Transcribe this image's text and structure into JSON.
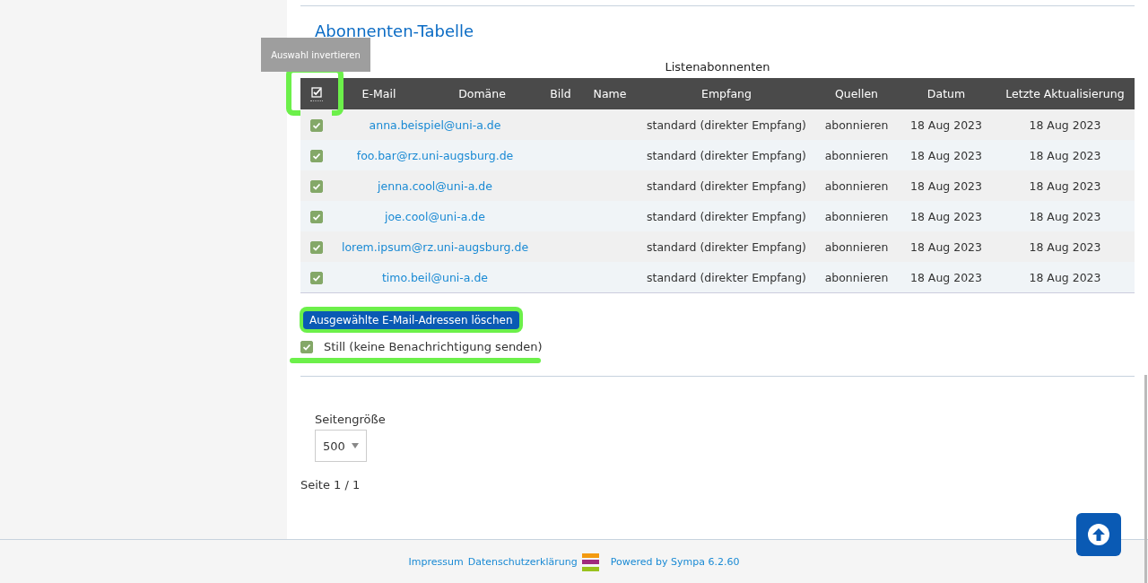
{
  "section_title": "Abonnenten-Tabelle",
  "tooltip": "Auswahl invertieren",
  "table": {
    "caption": "Listenabonnenten",
    "select_all": {
      "checked": true,
      "highlighted": true
    },
    "columns": [
      "E-Mail",
      "Domäne",
      "Bild",
      "Name",
      "Empfang",
      "Quellen",
      "Datum",
      "Letzte Aktualisierung"
    ],
    "rows": [
      {
        "checked": true,
        "email": "anna.beispiel@uni-a.de",
        "empfang": "standard (direkter Empfang)",
        "quellen": "abonnieren",
        "datum": "18 Aug 2023",
        "updated": "18 Aug 2023"
      },
      {
        "checked": true,
        "email": "foo.bar@rz.uni-augsburg.de",
        "empfang": "standard (direkter Empfang)",
        "quellen": "abonnieren",
        "datum": "18 Aug 2023",
        "updated": "18 Aug 2023"
      },
      {
        "checked": true,
        "email": "jenna.cool@uni-a.de",
        "empfang": "standard (direkter Empfang)",
        "quellen": "abonnieren",
        "datum": "18 Aug 2023",
        "updated": "18 Aug 2023"
      },
      {
        "checked": true,
        "email": "joe.cool@uni-a.de",
        "empfang": "standard (direkter Empfang)",
        "quellen": "abonnieren",
        "datum": "18 Aug 2023",
        "updated": "18 Aug 2023"
      },
      {
        "checked": true,
        "email": "lorem.ipsum@rz.uni-augsburg.de",
        "empfang": "standard (direkter Empfang)",
        "quellen": "abonnieren",
        "datum": "18 Aug 2023",
        "updated": "18 Aug 2023"
      },
      {
        "checked": true,
        "email": "timo.beil@uni-a.de",
        "empfang": "standard (direkter Empfang)",
        "quellen": "abonnieren",
        "datum": "18 Aug 2023",
        "updated": "18 Aug 2023"
      }
    ]
  },
  "delete_button": {
    "label": "Ausgewählte E-Mail-Adressen löschen",
    "highlighted": true
  },
  "quiet_option": {
    "label": "Still (keine Benachrichtigung senden)",
    "checked": true,
    "highlighted": true
  },
  "page_size": {
    "label": "Seitengröße",
    "value": "500"
  },
  "pagination": "Seite 1 / 1",
  "footer": {
    "links": [
      "Impressum",
      "Datenschutzerklärung"
    ],
    "powered_by": "Powered by Sympa 6.2.60"
  }
}
